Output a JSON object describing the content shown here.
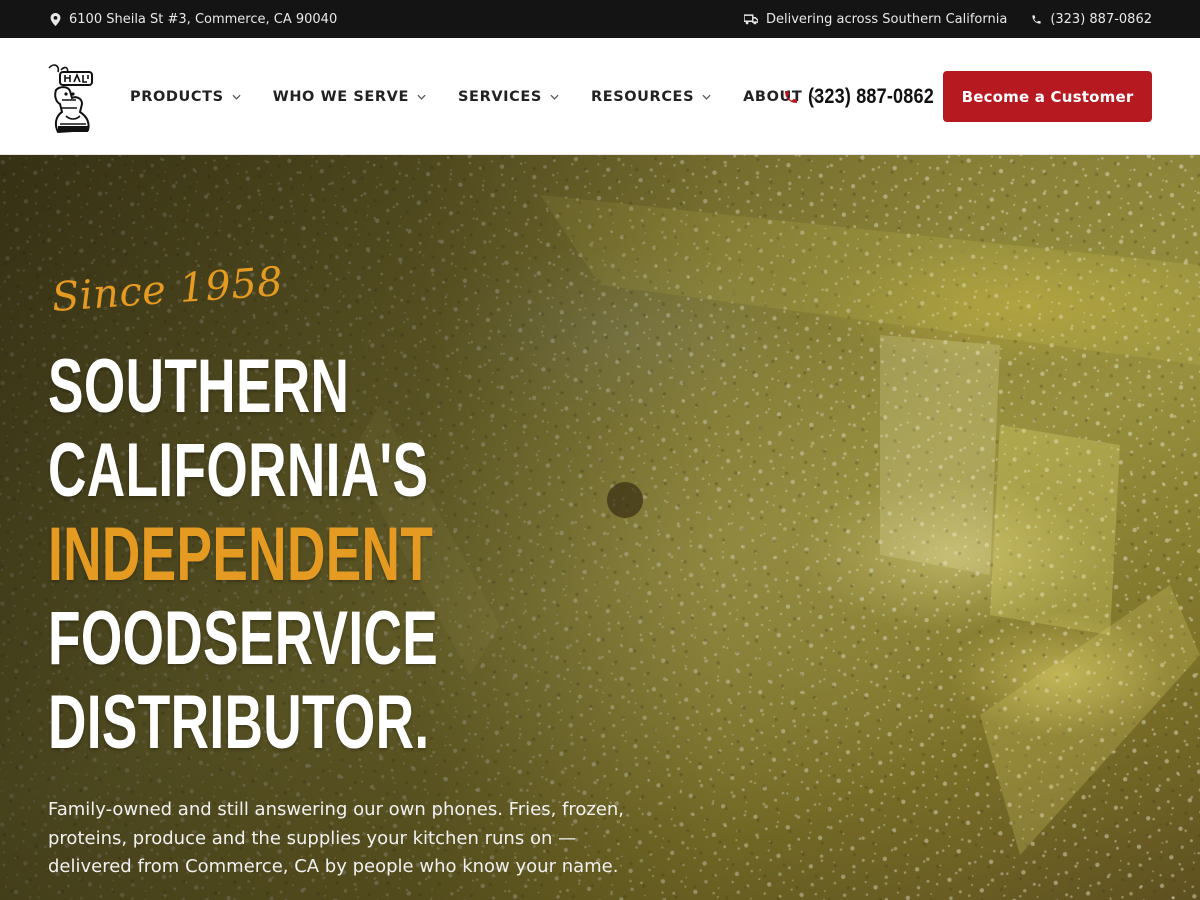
{
  "topbar": {
    "address": "6100 Sheila St #3, Commerce, CA 90040",
    "delivery": "Delivering across Southern California",
    "phone": "(323) 887-0862",
    "icons": {
      "address": "location-pin-icon",
      "delivery": "truck-icon",
      "phone": "phone-icon"
    }
  },
  "header": {
    "logo": {
      "icon": "brand-logo-icon"
    },
    "nav": [
      {
        "label": "PRODUCTS"
      },
      {
        "label": "WHO WE SERVE"
      },
      {
        "label": "SERVICES"
      },
      {
        "label": "RESOURCES"
      },
      {
        "label": "ABOUT"
      }
    ],
    "phone": "(323) 887-0862",
    "cta": "Become a Customer"
  },
  "hero": {
    "tagline": "Since 1958",
    "headline": [
      "SOUTHERN",
      "CALIFORNIA'S",
      "INDEPENDENT",
      "FOODSERVICE",
      "DISTRIBUTOR."
    ],
    "lede": "Family-owned and still answering our own phones. Fries, frozen, proteins, produce and the supplies your kitchen runs on — delivered from Commerce, CA by people who know your name."
  },
  "colors": {
    "accent": "#e59a22",
    "cta": "#b71920",
    "topbar": "#141414"
  }
}
